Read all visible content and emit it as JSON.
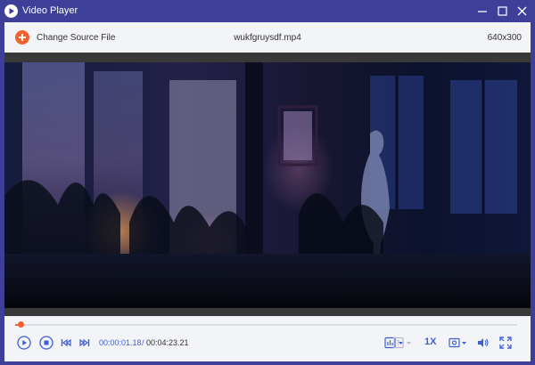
{
  "window": {
    "title": "Video Player",
    "minimize_icon": "minimize-icon",
    "maximize_icon": "maximize-icon",
    "close_icon": "close-icon"
  },
  "header": {
    "change_source_label": "Change Source File",
    "filename": "wukfgruysdf.mp4",
    "resolution": "640x300"
  },
  "video": {
    "description_icon": "video-frame"
  },
  "playback": {
    "progress": 0.01,
    "current_time": "00:00:01.18",
    "separator": "/",
    "total_time": "00:04:23.21",
    "speed": "1X"
  },
  "colors": {
    "titlebar": "#3d3f98",
    "accent_orange": "#f2622e",
    "control_blue": "#3d5fd6",
    "panel_bg": "#f3f4f8"
  }
}
